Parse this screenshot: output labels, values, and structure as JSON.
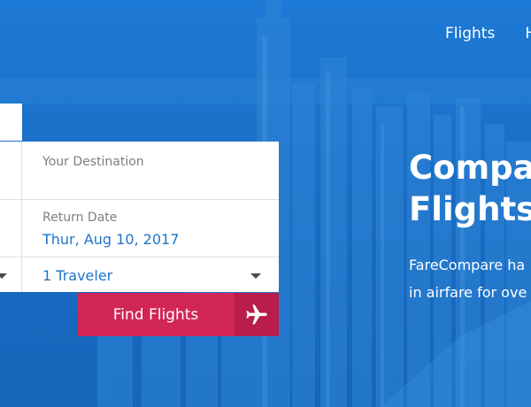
{
  "nav": {
    "items": [
      {
        "label": "Flights"
      },
      {
        "label": "H"
      }
    ]
  },
  "search": {
    "destination_label": "Your Destination",
    "destination_value": "",
    "return_label": "Return Date",
    "return_value": "Thur, Aug 10, 2017",
    "travelers_value": "1 Traveler",
    "find_button": "Find Flights",
    "find_icon": "airplane-icon"
  },
  "hero": {
    "headline_line1": "Compa",
    "headline_line2": "Flights",
    "sub_line1": "FareCompare ha",
    "sub_line2": "in airfare for ove"
  },
  "colors": {
    "hero_blue": "#1b74c9",
    "accent": "#d12656",
    "accent_dark": "#b81d4b",
    "link_blue": "#1f73c8"
  }
}
